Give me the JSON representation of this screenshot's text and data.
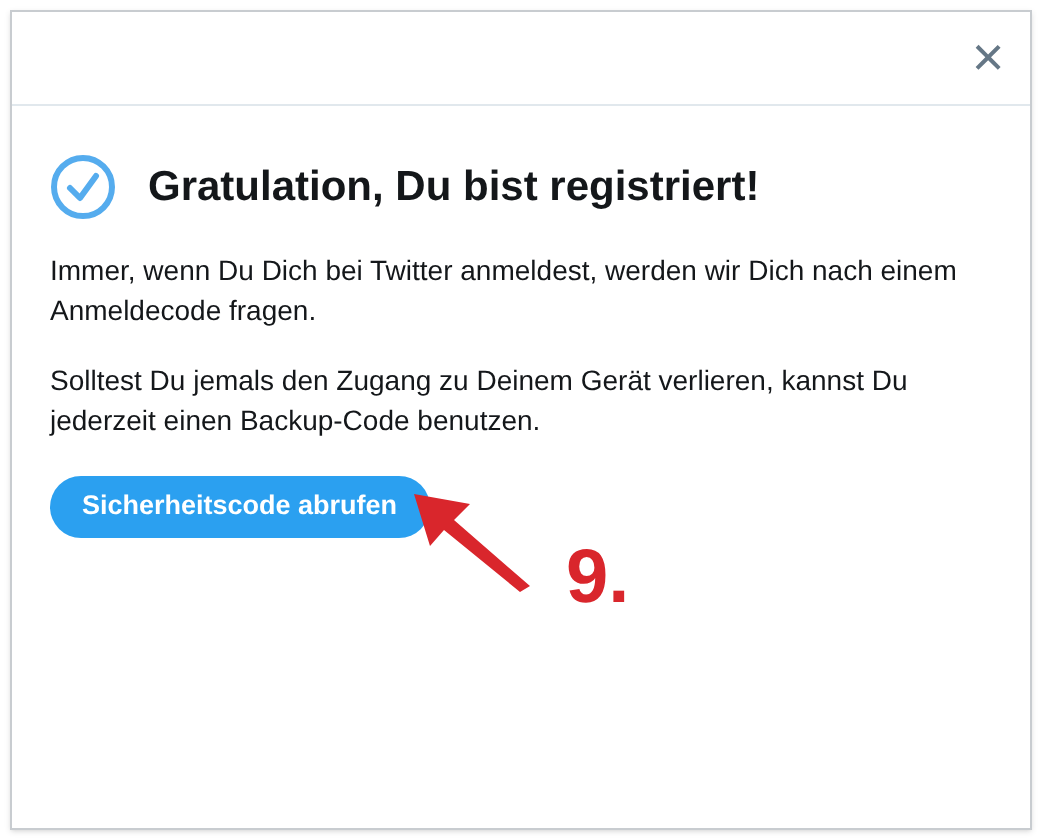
{
  "dialog": {
    "close": "×",
    "title": "Gratulation, Du bist registriert!",
    "paragraphs": [
      "Immer, wenn Du Dich bei Twitter anmeldest, werden wir Dich nach einem Anmeldecode fragen.",
      "Solltest Du jemals den Zugang zu Deinem Gerät verlieren, kannst Du jederzeit einen Backup-Code benutzen."
    ],
    "button": "Sicherheitscode abrufen"
  },
  "annotation": {
    "label": "9."
  }
}
